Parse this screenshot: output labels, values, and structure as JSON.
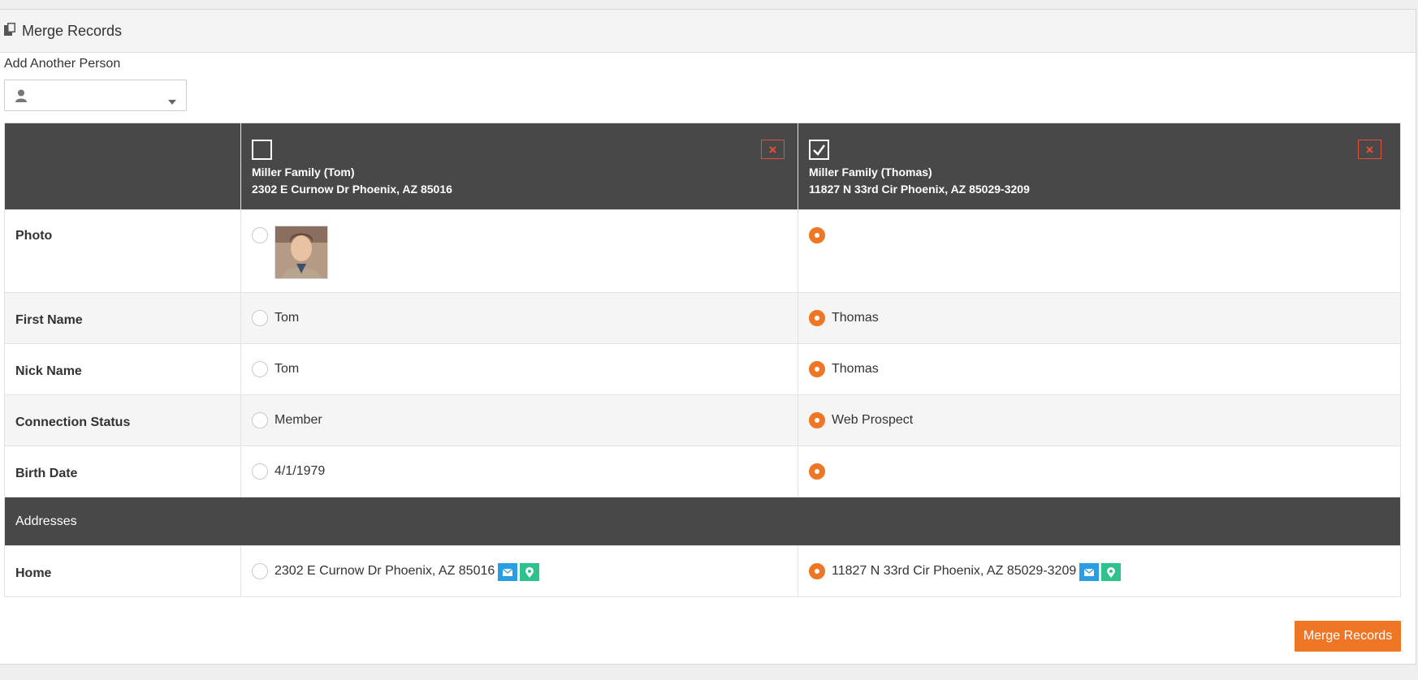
{
  "panel": {
    "title": "Merge Records"
  },
  "add_person": {
    "label": "Add Another Person",
    "value": ""
  },
  "people": [
    {
      "checked": false,
      "family": "Miller Family (Tom)",
      "address": "2302 E Curnow Dr Phoenix, AZ 85016"
    },
    {
      "checked": true,
      "family": "Miller Family (Thomas)",
      "address": "11827 N 33rd Cir Phoenix, AZ 85029-3209"
    }
  ],
  "rows": {
    "photo": {
      "label": "Photo"
    },
    "first_name": {
      "label": "First Name",
      "a": "Tom",
      "b": "Thomas"
    },
    "nick_name": {
      "label": "Nick Name",
      "a": "Tom",
      "b": "Thomas"
    },
    "connection_status": {
      "label": "Connection Status",
      "a": "Member",
      "b": "Web Prospect"
    },
    "birth_date": {
      "label": "Birth Date",
      "a": "4/1/1979",
      "b": ""
    }
  },
  "addresses": {
    "section_title": "Addresses",
    "home": {
      "label": "Home",
      "a": "2302 E Curnow Dr Phoenix, AZ 85016",
      "b": "11827 N 33rd Cir Phoenix, AZ 85029-3209"
    }
  },
  "merge_button": "Merge Records",
  "colors": {
    "accent": "#ee7624",
    "header_bg": "#484848",
    "remove": "#e0503a",
    "mail": "#2a9ee4",
    "map": "#2ec28c"
  },
  "icons": [
    "copy-icon",
    "user-icon",
    "caret-down-icon",
    "checkbox-icon",
    "close-icon",
    "envelope-icon",
    "map-marker-icon"
  ]
}
